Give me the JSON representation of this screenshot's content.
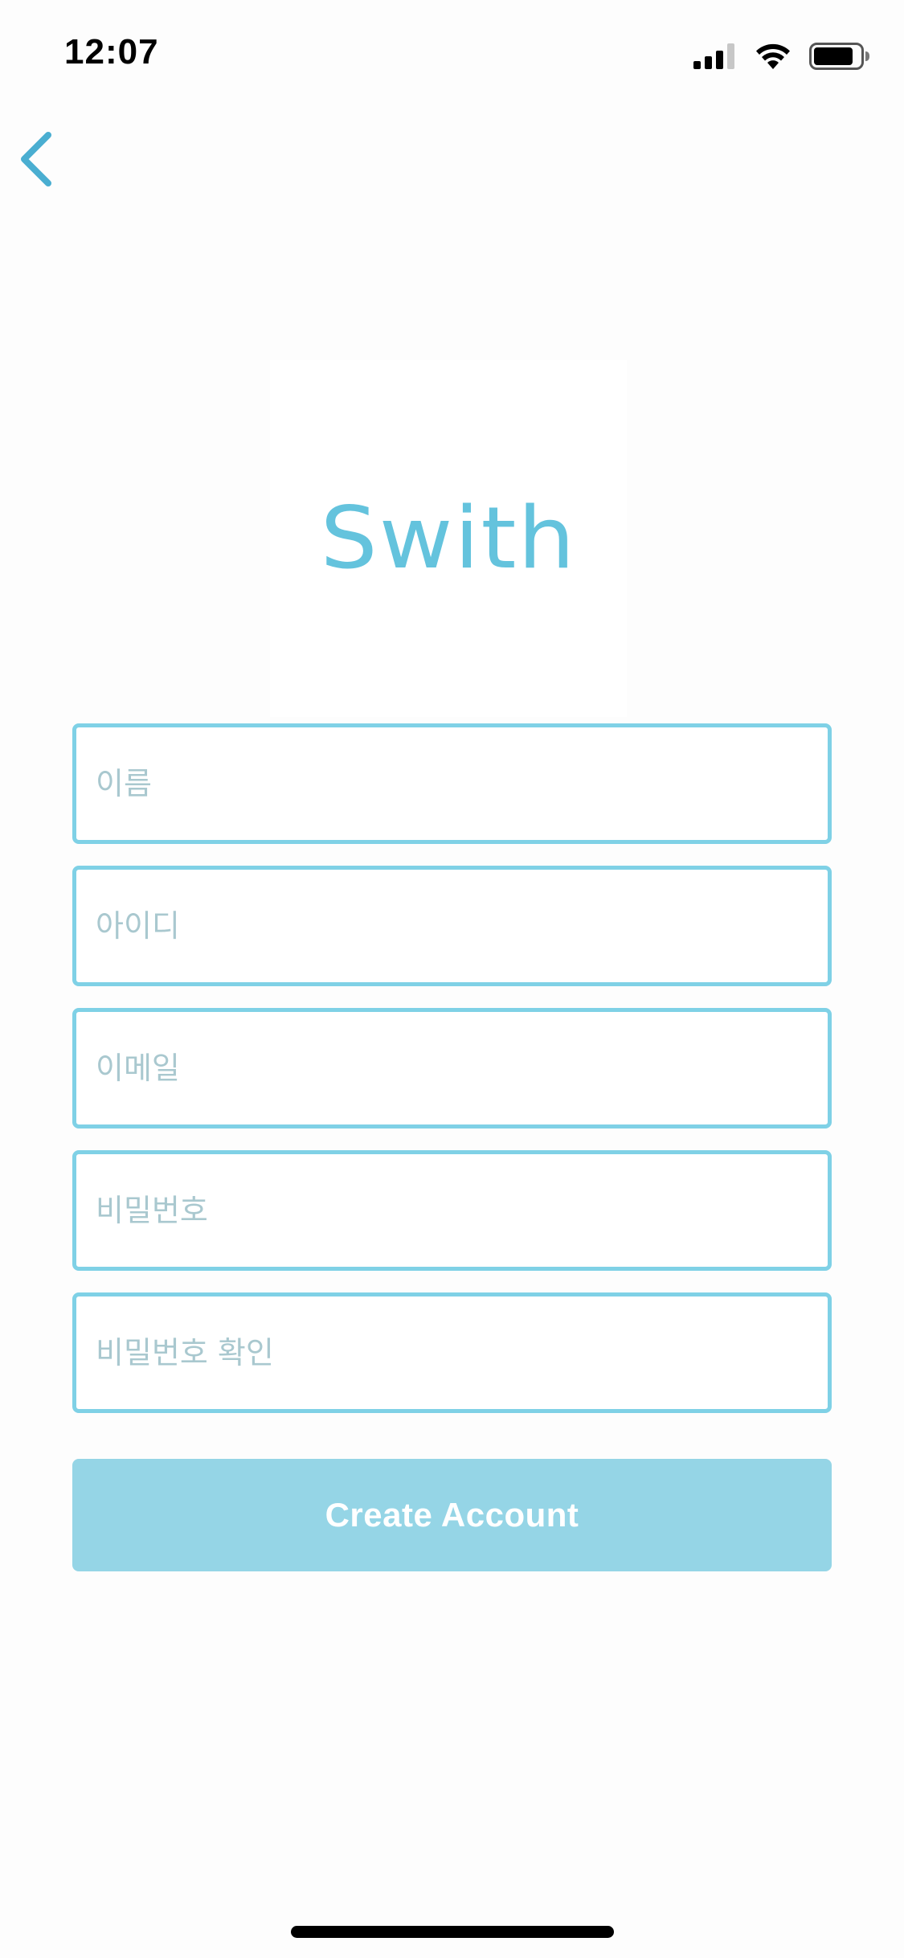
{
  "status_bar": {
    "time": "12:07",
    "icons": [
      "cellular-signal-icon",
      "wifi-icon",
      "battery-icon"
    ]
  },
  "nav": {
    "back_icon": "chevron-left-icon",
    "accent_color": "#4aaed1"
  },
  "logo": {
    "text": "Swith",
    "color": "#5cc0dc"
  },
  "form": {
    "name_placeholder": "이름",
    "id_placeholder": "아이디",
    "email_placeholder": "이메일",
    "password_placeholder": "비밀번호",
    "password_confirm_placeholder": "비밀번호 확인",
    "border_color": "#7fd1e6"
  },
  "actions": {
    "create_account_label": "Create Account",
    "button_color": "#95d5e6"
  }
}
